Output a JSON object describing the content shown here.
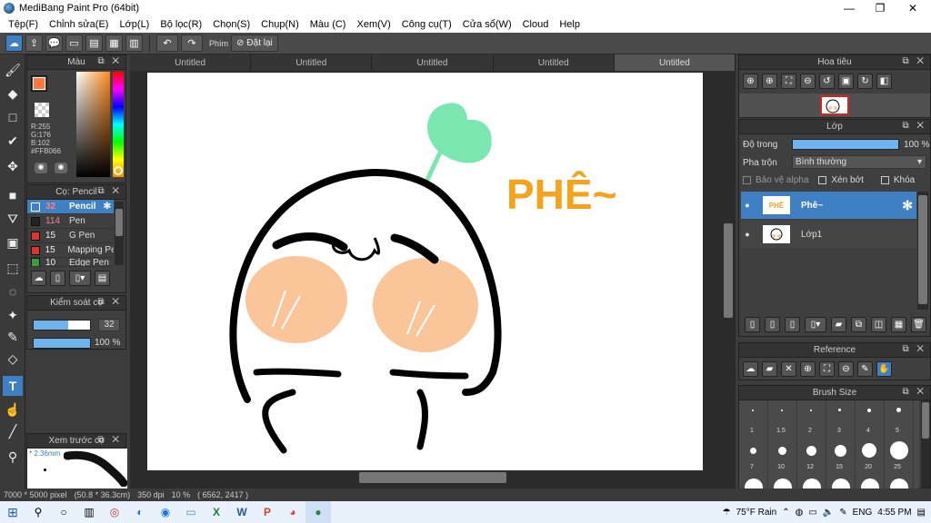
{
  "window": {
    "title": "MediBang Paint Pro (64bit)",
    "controls": [
      "—",
      "❐",
      "✕"
    ]
  },
  "menu": [
    "Tệp(F)",
    "Chỉnh sửa(E)",
    "Lớp(L)",
    "Bộ lọc(R)",
    "Chọn(S)",
    "Chụp(N)",
    "Màu (C)",
    "Xem(V)",
    "Công cụ(T)",
    "Cửa sổ(W)",
    "Cloud",
    "Help"
  ],
  "toolbar": {
    "shortcut_label": "Phím",
    "reset_label": "Đặt lại"
  },
  "tabs": [
    "Untitled",
    "Untitled",
    "Untitled",
    "Untitled",
    "Untitled"
  ],
  "color_panel": {
    "title": "Màu",
    "r": "R:255",
    "g": "G:176",
    "b": "B:102",
    "hex": "#FFB066",
    "fg": "#FFB066"
  },
  "brush_panel": {
    "title": "Cọ: Pencil",
    "items": [
      {
        "size": "32",
        "name": "Pencil",
        "color": "#e03030"
      },
      {
        "size": "114",
        "name": "Pen",
        "color": "#222222"
      },
      {
        "size": "15",
        "name": "G Pen",
        "color": "#e03030"
      },
      {
        "size": "15",
        "name": "Mapping Pe",
        "color": "#e03030"
      },
      {
        "size": "10",
        "name": "Edge Pen",
        "color": "#3aa03a"
      }
    ]
  },
  "brush_control": {
    "title": "Kiểm soát cọ",
    "size_value": "32",
    "opacity_value": "100 %"
  },
  "preview": {
    "title": "Xem trước cọ",
    "size_text": "* 2.36mm"
  },
  "artwork": {
    "text": "PHÊ~",
    "text_color": "#f5a31a",
    "leaf_color": "#7be7b0",
    "blush_color": "#fbc59a"
  },
  "navigator": {
    "title": "Hoa tiêu"
  },
  "layers": {
    "title": "Lớp",
    "opacity_label": "Độ trong",
    "opacity_value": "100 %",
    "blend_label": "Pha trộn",
    "blend_value": "Bình thường",
    "protect_alpha": "Bảo vệ alpha",
    "clipping": "Xén bớt",
    "lock": "Khóa",
    "items": [
      {
        "name": "Phê~",
        "thumb": "PHÊ"
      },
      {
        "name": "Lớp1",
        "thumb": ""
      }
    ]
  },
  "reference": {
    "title": "Reference"
  },
  "brush_size": {
    "title": "Brush Size",
    "row1": [
      "1",
      "1.5",
      "2",
      "3",
      "4",
      "5"
    ],
    "row2": [
      "7",
      "10",
      "12",
      "15",
      "20",
      "25"
    ]
  },
  "status": {
    "dims": "7000 * 5000 pixel",
    "cm": "(50.8 * 36.3cm)",
    "dpi": "350 dpi",
    "zoom": "10 %",
    "coords": "( 6562, 2417 )"
  },
  "taskbar": {
    "weather": "75°F  Rain",
    "lang": "ENG",
    "time": "4:55 PM"
  }
}
